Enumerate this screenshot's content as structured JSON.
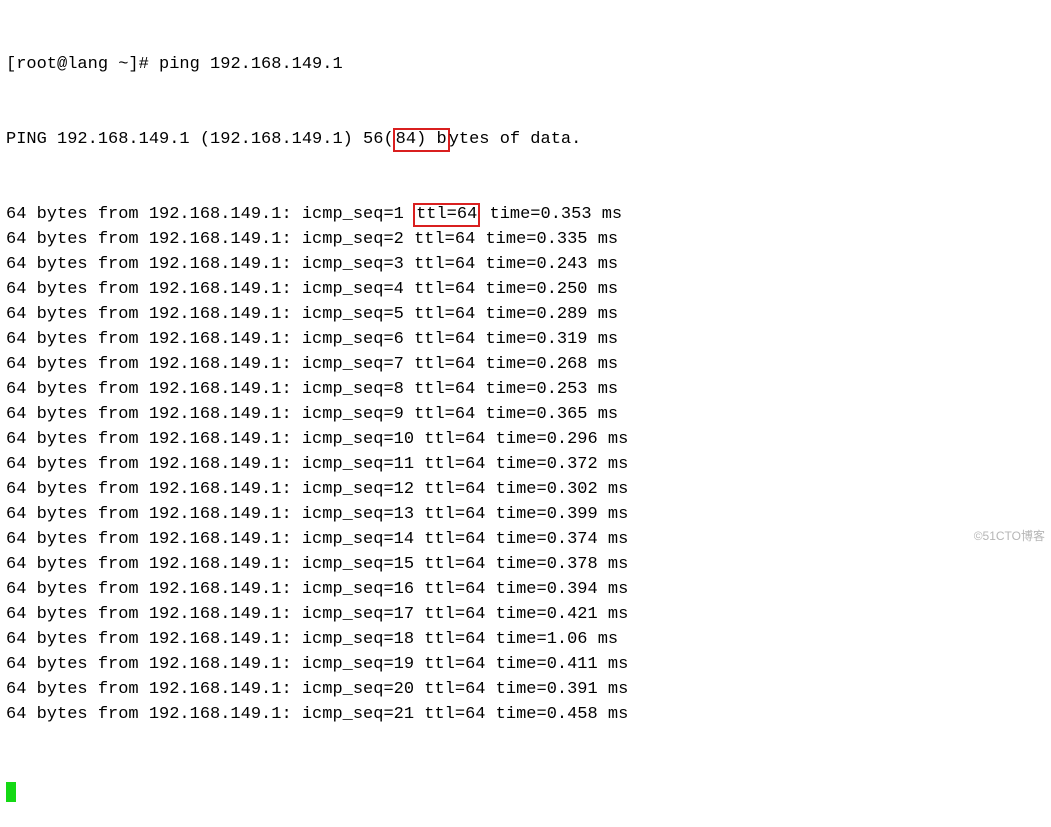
{
  "prompt": "[root@lang ~]# ",
  "command": "ping 192.168.149.1",
  "header": {
    "prefix": "PING 192.168.149.1 (192.168.149.1) 56(",
    "mid": "84) b",
    "suffix": "ytes of data."
  },
  "ip": "192.168.149.1",
  "highlight_ttl": "ttl=64",
  "replies": [
    {
      "seq": 1,
      "ttl": 64,
      "time": "0.353"
    },
    {
      "seq": 2,
      "ttl": 64,
      "time": "0.335"
    },
    {
      "seq": 3,
      "ttl": 64,
      "time": "0.243"
    },
    {
      "seq": 4,
      "ttl": 64,
      "time": "0.250"
    },
    {
      "seq": 5,
      "ttl": 64,
      "time": "0.289"
    },
    {
      "seq": 6,
      "ttl": 64,
      "time": "0.319"
    },
    {
      "seq": 7,
      "ttl": 64,
      "time": "0.268"
    },
    {
      "seq": 8,
      "ttl": 64,
      "time": "0.253"
    },
    {
      "seq": 9,
      "ttl": 64,
      "time": "0.365"
    },
    {
      "seq": 10,
      "ttl": 64,
      "time": "0.296"
    },
    {
      "seq": 11,
      "ttl": 64,
      "time": "0.372"
    },
    {
      "seq": 12,
      "ttl": 64,
      "time": "0.302"
    },
    {
      "seq": 13,
      "ttl": 64,
      "time": "0.399"
    },
    {
      "seq": 14,
      "ttl": 64,
      "time": "0.374"
    },
    {
      "seq": 15,
      "ttl": 64,
      "time": "0.378"
    },
    {
      "seq": 16,
      "ttl": 64,
      "time": "0.394"
    },
    {
      "seq": 17,
      "ttl": 64,
      "time": "0.421"
    },
    {
      "seq": 18,
      "ttl": 64,
      "time": "1.06"
    },
    {
      "seq": 19,
      "ttl": 64,
      "time": "0.411"
    },
    {
      "seq": 20,
      "ttl": 64,
      "time": "0.391"
    },
    {
      "seq": 21,
      "ttl": 64,
      "time": "0.458"
    }
  ],
  "watermark": "©51CTO博客"
}
